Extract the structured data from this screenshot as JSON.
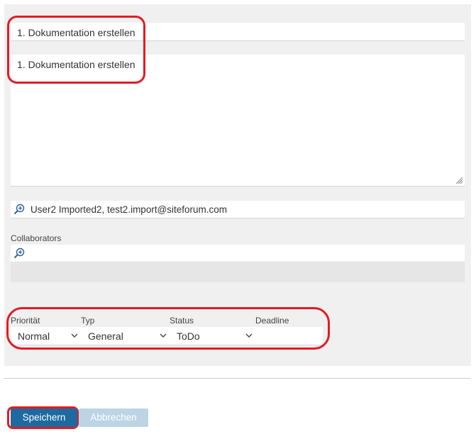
{
  "form": {
    "title_value": "1. Dokumentation erstellen",
    "description_value": "1. Dokumentation erstellen",
    "assignee_value": "User2 Imported2, test2.import@siteforum.com",
    "collaborators_label": "Collaborators",
    "collaborators_value": ""
  },
  "meta": {
    "priority_label": "Priorität",
    "priority_value": "Normal",
    "type_label": "Typ",
    "type_value": "General",
    "status_label": "Status",
    "status_value": "ToDo",
    "deadline_label": "Deadline",
    "deadline_value": ""
  },
  "actions": {
    "save_label": "Speichern",
    "cancel_label": "Abbrechen"
  },
  "colors": {
    "highlight": "#e31b23",
    "primary_button": "#1d6aa0",
    "disabled_button": "#bcd4e4",
    "panel_bg": "#f0f0f0"
  },
  "icons": {
    "lookup": "magnifier-plus-icon",
    "dropdown": "chevron-down-icon",
    "resize": "resize-grip-icon"
  }
}
